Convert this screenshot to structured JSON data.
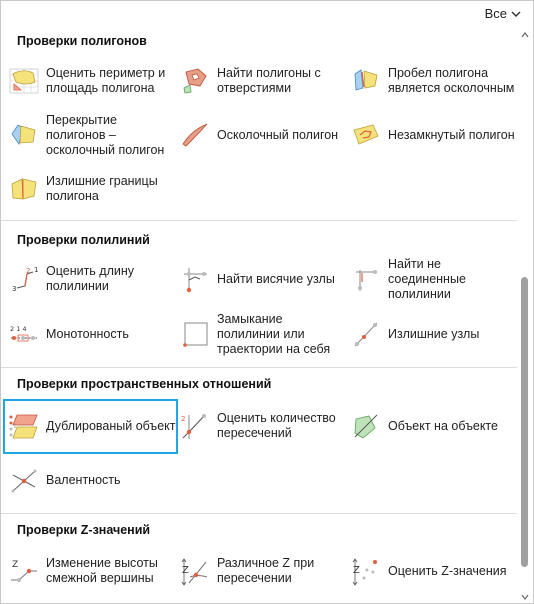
{
  "filter": {
    "label": "Все"
  },
  "sections": [
    {
      "title": "Проверки полигонов",
      "items": [
        {
          "label": "Оценить периметр и\nплощадь полигона",
          "icon": "polygon-perimeter-area-icon"
        },
        {
          "label": "Найти полигоны с\nотверстиями",
          "icon": "polygon-holes-icon"
        },
        {
          "label": "Пробел полигона\nявляется осколочным",
          "icon": "polygon-gap-sliver-icon"
        },
        {
          "label": "Перекрытие\nполигонов –\nосколочный полигон",
          "icon": "polygon-overlap-sliver-icon"
        },
        {
          "label": "Осколочный полигон",
          "icon": "sliver-polygon-icon"
        },
        {
          "label": "Незамкнутый полигон",
          "icon": "unclosed-polygon-icon"
        },
        {
          "label": "Излишние границы\nполигона",
          "icon": "redundant-boundary-icon"
        }
      ]
    },
    {
      "title": "Проверки полилиний",
      "items": [
        {
          "label": "Оценить длину\nполилинии",
          "icon": "polyline-length-icon"
        },
        {
          "label": "Найти висячие узлы",
          "icon": "dangling-nodes-icon"
        },
        {
          "label": "Найти не соединенные\nполилинии",
          "icon": "unconnected-polylines-icon"
        },
        {
          "label": "Монотонность",
          "icon": "monotonicity-icon"
        },
        {
          "label": "Замыкание\nполилинии или\nтраектории на себя",
          "icon": "self-closure-icon"
        },
        {
          "label": "Излишние узлы",
          "icon": "redundant-nodes-icon"
        }
      ]
    },
    {
      "title": "Проверки пространственных отношений",
      "items": [
        {
          "label": "Дублированый объект",
          "icon": "duplicate-object-icon"
        },
        {
          "label": "Оценить количество\nпересечений",
          "icon": "intersection-count-icon"
        },
        {
          "label": "Объект на объекте",
          "icon": "object-on-object-icon"
        },
        {
          "label": "Валентность",
          "icon": "valence-icon"
        }
      ]
    },
    {
      "title": "Проверки Z-значений",
      "items": [
        {
          "label": "Изменение высоты\nсмежной вершины",
          "icon": "adjacent-vertex-height-icon"
        },
        {
          "label": "Различное Z при\nпересечении",
          "icon": "different-z-intersection-icon"
        },
        {
          "label": "Оценить Z-значения",
          "icon": "evaluate-z-icon"
        }
      ]
    }
  ],
  "colors": {
    "polygon_fill": "#f5e27a",
    "accent_red": "#e06040",
    "select_border": "#1ea7e1",
    "blue_fill": "#a8d0f0"
  }
}
